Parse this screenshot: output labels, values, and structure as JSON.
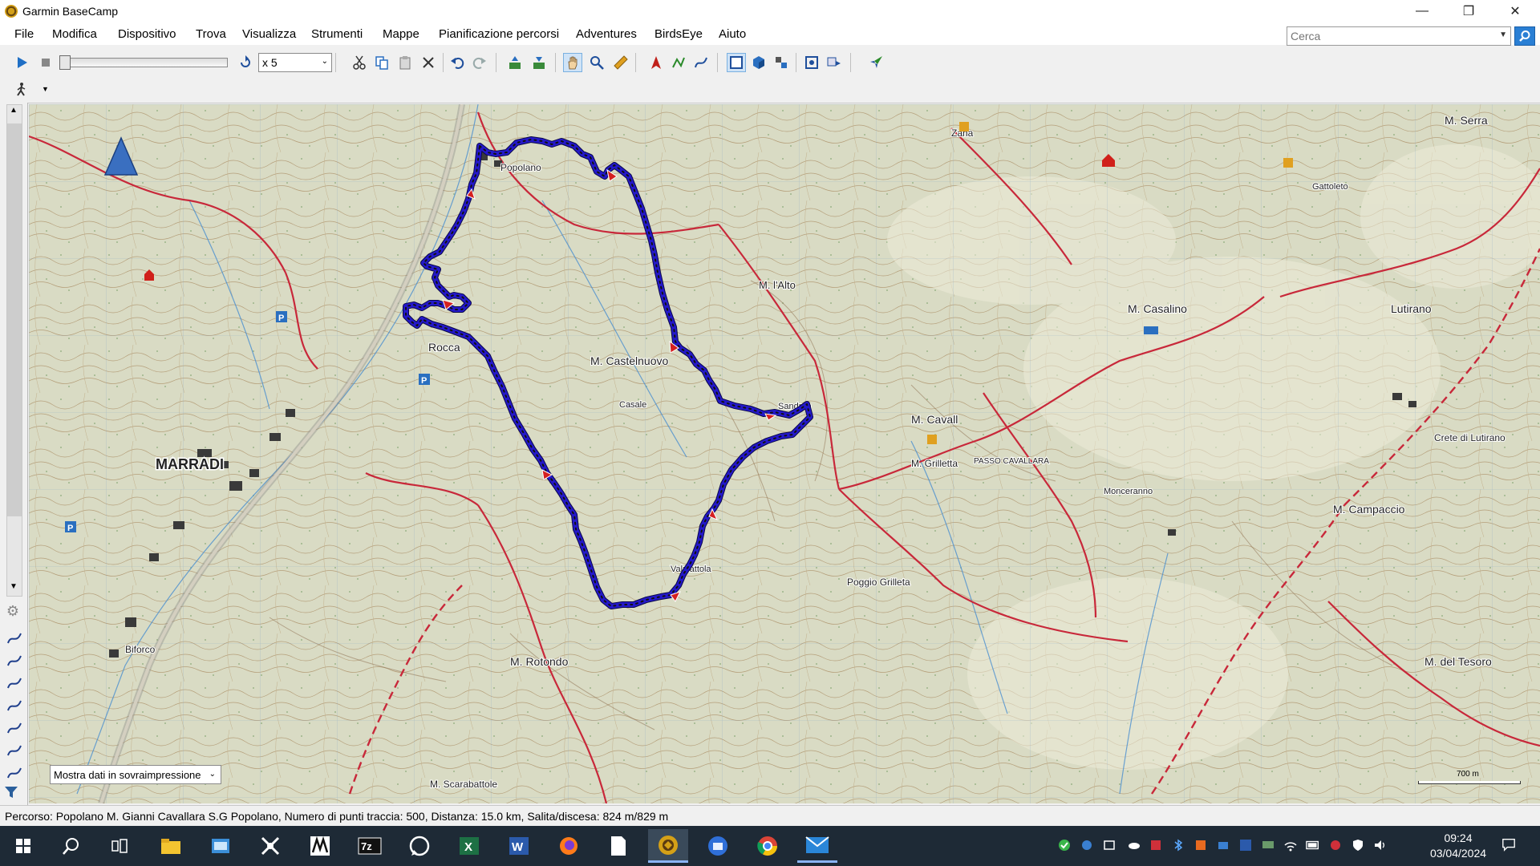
{
  "window": {
    "title": "Garmin BaseCamp"
  },
  "menu": {
    "items": [
      "File",
      "Modifica",
      "Dispositivo",
      "Trova",
      "Visualizza",
      "Strumenti",
      "Mappe",
      "Pianificazione percorsi",
      "Adventures",
      "BirdsEye",
      "Aiuto"
    ]
  },
  "search": {
    "placeholder": "Cerca"
  },
  "toolbar": {
    "playback_speed": "x 5"
  },
  "map": {
    "overlay_select": "Mostra dati in sovraimpressione",
    "scale_label": "700 m",
    "place_labels": [
      {
        "text": "MARRADI"
      },
      {
        "text": "Popolano"
      },
      {
        "text": "M. l'Alto"
      },
      {
        "text": "M. Castelnuovo"
      },
      {
        "text": "M. Cavall"
      },
      {
        "text": "M. Casalino"
      },
      {
        "text": "Lutirano"
      },
      {
        "text": "M. Rotondo"
      },
      {
        "text": "M. Campaccio"
      },
      {
        "text": "M. del Tesoro"
      },
      {
        "text": "Rocca"
      },
      {
        "text": "Biforco"
      },
      {
        "text": "M. Serra"
      },
      {
        "text": "Crete di Lutirano"
      },
      {
        "text": "Poggio Grilleta"
      },
      {
        "text": "M. Grilletta"
      },
      {
        "text": "Zana"
      },
      {
        "text": "M. Scarabattole"
      },
      {
        "text": "Casale"
      },
      {
        "text": "Sandron"
      },
      {
        "text": "PASSO CAVALLARA"
      },
      {
        "text": "Monceranno"
      },
      {
        "text": "Gattoleto"
      },
      {
        "text": "Valpiattola"
      }
    ],
    "route_color": "#2418c9"
  },
  "status": {
    "text": "Percorso: Popolano M. Gianni Cavallara S.G Popolano, Numero di punti traccia: 500, Distanza: 15.0 km, Salita/discesa: 824 m/829 m"
  },
  "taskbar": {
    "apps": [
      "start-icon",
      "search-icon",
      "task-view-icon",
      "file-explorer-icon",
      "outlook-icon",
      "drone-app-icon",
      "metrix-icon",
      "7zip-icon",
      "whatsapp-icon",
      "excel-icon",
      "word-icon",
      "firefox-icon",
      "notepad-icon",
      "garmin-basecamp-icon",
      "thunderbird-icon",
      "chrome-icon",
      "mail-icon"
    ],
    "clock_time": "09:24",
    "clock_date": "03/04/2024"
  },
  "colors": {
    "titlebar": "#ffffff",
    "taskbar": "#1e2a36",
    "accent": "#2a7fd4"
  }
}
